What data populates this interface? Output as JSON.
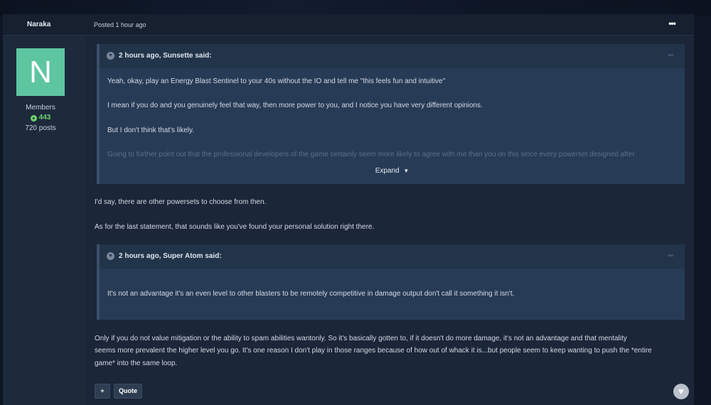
{
  "post": {
    "author": "Naraka",
    "posted": "Posted 1 hour ago",
    "more_icon": "more-options-icon",
    "avatar_letter": "N",
    "member_group": "Members",
    "reputation": "443",
    "post_count": "720 posts"
  },
  "quote1": {
    "citation": "2 hours ago, Sunsette said:",
    "lines": [
      "Yeah, okay, play an Energy Blast Sentinel to your 40s without the IO and tell me \"this feels fun and intuitive\"",
      "I mean if you do and you genuinely feel that way, then more power to you, and I notice you have very different opinions.",
      "But I don't think that's likely.",
      "Going to further point out that the professional developers of the game certainly seem more likely to agree with me than you on this since every powerset designed after"
    ],
    "expand_label": "Expand"
  },
  "reply1": {
    "lines": [
      "I'd say, there are other powersets to choose from then.",
      "As for the last statement, that sounds like you've found your personal solution right there."
    ]
  },
  "quote2": {
    "citation": "2 hours ago, Super Atom said:",
    "lines": [
      "It's not an advantage it's an even level to other blasters to be remotely competitive in damage output don't call it something it isn't."
    ]
  },
  "reply2": {
    "lines": [
      "Only if you do not value mitigation or the ability to spam abilities wantonly.  So it's basically gotten to, if it doesn't do more damage, it's not an advantage and that mentality",
      "seems more prevalent the higher level you go.  It's one reason I don't play in those ranges because of how out of whack it is...but people seem to keep wanting to push the *entire",
      "game* into the same loop."
    ]
  },
  "actions": {
    "multiquote_label": "+",
    "quote_label": "Quote"
  },
  "colors": {
    "avatar": "#5ec5a1",
    "reputation": "#6fd66e",
    "quote_bg": "#283b56",
    "post_bg": "#1b2638"
  }
}
